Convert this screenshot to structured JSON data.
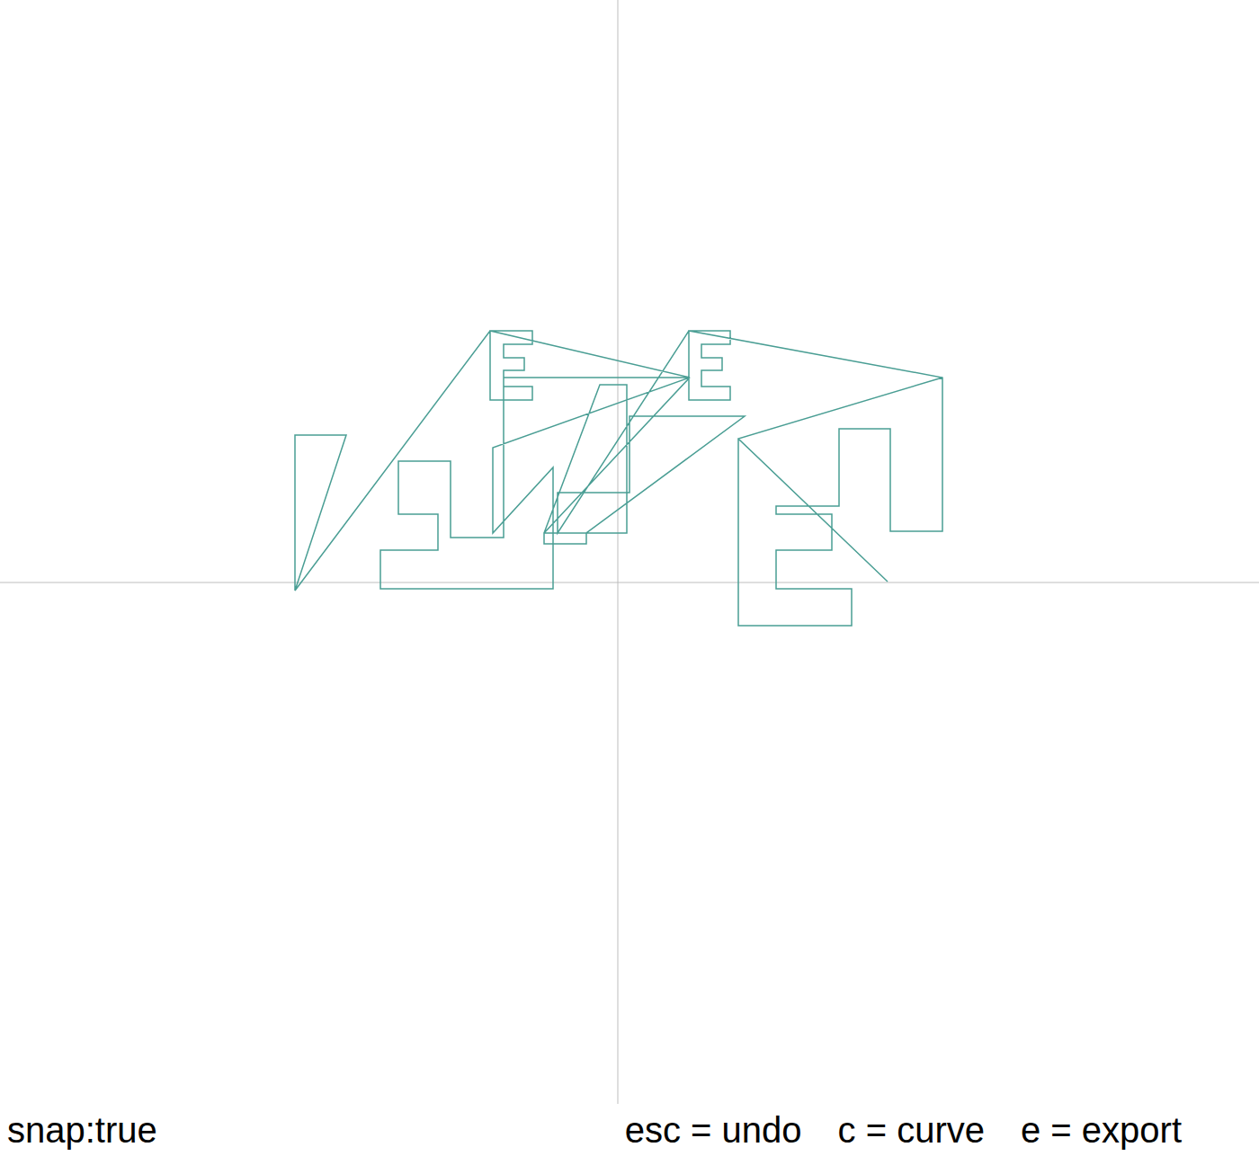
{
  "status": {
    "snap": "snap:true"
  },
  "shortcuts": [
    "esc = undo",
    "c = curve",
    "e = export"
  ],
  "drawing": {
    "points": [
      [
        -359,
        -9
      ],
      [
        -359,
        164
      ],
      [
        -302,
        164
      ],
      [
        -359,
        -9
      ],
      [
        -142,
        280
      ],
      [
        -95,
        280
      ],
      [
        -95,
        265
      ],
      [
        -127,
        265
      ],
      [
        -127,
        250
      ],
      [
        -104,
        250
      ],
      [
        -104,
        236
      ],
      [
        -127,
        236
      ],
      [
        -127,
        218
      ],
      [
        -95,
        218
      ],
      [
        -95,
        203
      ],
      [
        -142,
        203
      ],
      [
        -142,
        280
      ],
      [
        80,
        228
      ],
      [
        -127,
        228
      ],
      [
        -127,
        50
      ],
      [
        -186,
        50
      ],
      [
        -186,
        135
      ],
      [
        -244,
        135
      ],
      [
        -244,
        76
      ],
      [
        -200,
        76
      ],
      [
        -200,
        36
      ],
      [
        -264,
        36
      ],
      [
        -264,
        -7
      ],
      [
        -72,
        -7
      ],
      [
        -72,
        128
      ],
      [
        -139,
        55
      ],
      [
        -139,
        150
      ],
      [
        80,
        228
      ],
      [
        -82,
        55
      ],
      [
        -20,
        220
      ],
      [
        10,
        220
      ],
      [
        10,
        55
      ],
      [
        -82,
        55
      ],
      [
        -82,
        43
      ],
      [
        -35,
        43
      ],
      [
        -35,
        55
      ],
      [
        141,
        185
      ],
      [
        13,
        185
      ],
      [
        13,
        100
      ],
      [
        -67,
        100
      ],
      [
        -67,
        55
      ],
      [
        79,
        280
      ],
      [
        125,
        280
      ],
      [
        125,
        265
      ],
      [
        93,
        265
      ],
      [
        93,
        250
      ],
      [
        116,
        250
      ],
      [
        116,
        236
      ],
      [
        93,
        236
      ],
      [
        93,
        218
      ],
      [
        125,
        218
      ],
      [
        125,
        203
      ],
      [
        79,
        203
      ],
      [
        79,
        280
      ],
      [
        361,
        228
      ],
      [
        361,
        57
      ],
      [
        303,
        57
      ],
      [
        303,
        171
      ],
      [
        246,
        171
      ],
      [
        246,
        85
      ],
      [
        176,
        85
      ],
      [
        176,
        76
      ],
      [
        238,
        76
      ],
      [
        238,
        36
      ],
      [
        176,
        36
      ],
      [
        176,
        -7
      ],
      [
        260,
        -7
      ],
      [
        260,
        -48
      ],
      [
        134,
        -48
      ],
      [
        134,
        160
      ],
      [
        361,
        228
      ],
      [
        134,
        160
      ],
      [
        300,
        1
      ]
    ]
  }
}
